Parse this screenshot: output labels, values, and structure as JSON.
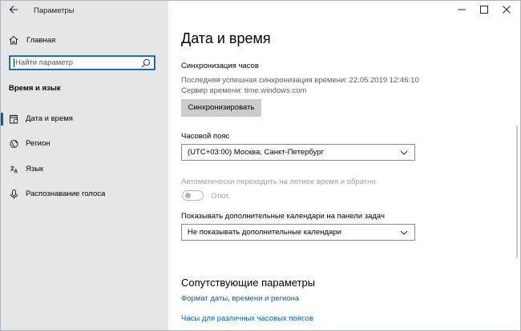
{
  "window": {
    "title": "Параметры",
    "controls": {
      "minimize": "minimize-icon",
      "maximize": "maximize-icon",
      "close": "close-icon"
    }
  },
  "sidebar": {
    "home_label": "Главная",
    "search_placeholder": "Найти параметр",
    "category": "Время и язык",
    "items": [
      {
        "label": "Дата и время",
        "icon": "calendar-clock-icon",
        "selected": true
      },
      {
        "label": "Регион",
        "icon": "globe-icon",
        "selected": false
      },
      {
        "label": "Язык",
        "icon": "language-icon",
        "selected": false
      },
      {
        "label": "Распознавание голоса",
        "icon": "microphone-icon",
        "selected": false
      }
    ]
  },
  "main": {
    "title": "Дата и время",
    "sync": {
      "heading": "Синхронизация часов",
      "last_sync": "Последняя успешная синхронизация времени: 22.05.2019 12:46:10",
      "server": "Сервер времени: time.windows.com",
      "button": "Синхронизировать"
    },
    "timezone": {
      "label": "Часовой пояс",
      "value": "(UTC+03:00) Москва, Санкт-Петербург"
    },
    "dst": {
      "label": "Автоматически переходить на летнее время и обратно",
      "state": "Откл.",
      "enabled": false
    },
    "calendars": {
      "label": "Показывать дополнительные календари на панели задач",
      "value": "Не показывать дополнительные календари"
    },
    "related": {
      "heading": "Сопутствующие параметры",
      "links": [
        "Формат даты, времени и региона",
        "Часы для различных часовых поясов"
      ]
    }
  },
  "colors": {
    "accent": "#0063b1",
    "sidebar_bg": "#e6e6e6",
    "button_bg": "#cccccc",
    "disabled_text": "#a0a0a0"
  }
}
